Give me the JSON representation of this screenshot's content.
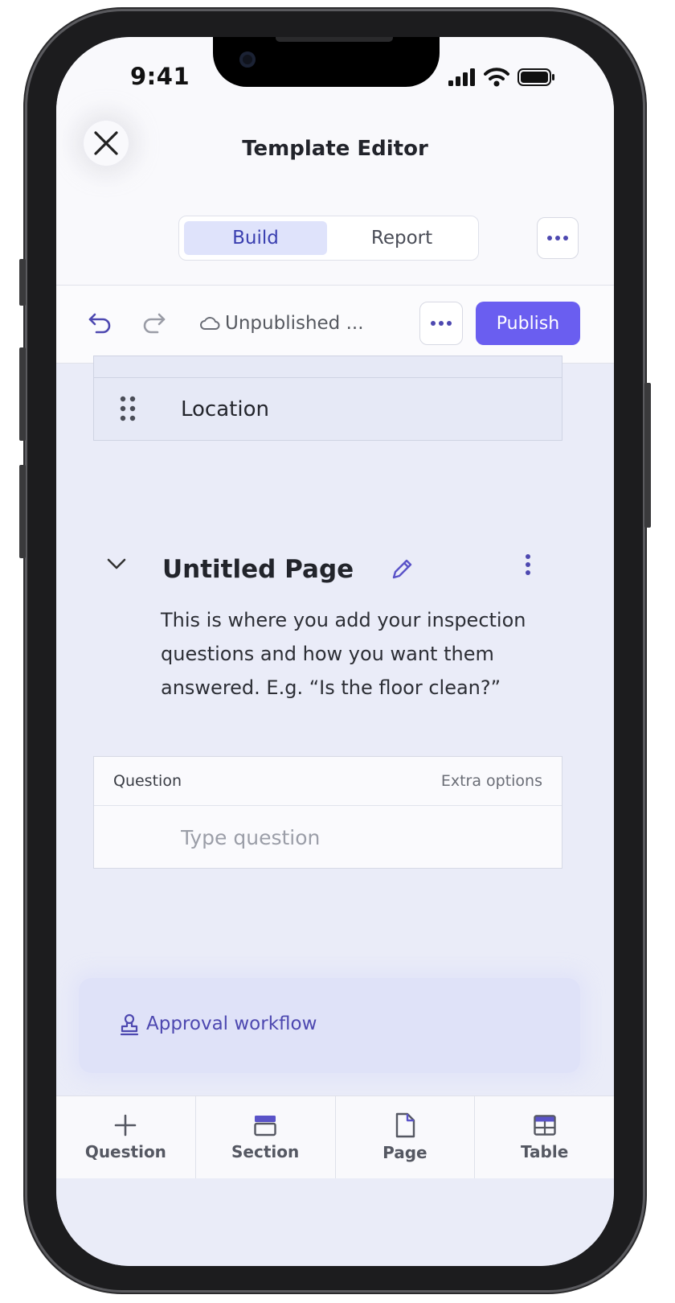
{
  "status_bar": {
    "time": "9:41"
  },
  "header": {
    "title": "Template Editor",
    "tabs": [
      {
        "label": "Build",
        "active": true
      },
      {
        "label": "Report",
        "active": false
      }
    ]
  },
  "toolbar": {
    "status": "Unpublished ...",
    "publish_label": "Publish"
  },
  "content": {
    "previous_item_label": "Location",
    "page": {
      "title": "Untitled Page",
      "description": "This is where you add your inspection questions and how you want them answered. E.g. “Is the floor clean?”"
    },
    "question_card": {
      "header_left": "Question",
      "header_right": "Extra options",
      "placeholder": "Type question"
    },
    "approval": {
      "label": "Approval workflow"
    }
  },
  "bottom_bar": {
    "items": [
      {
        "label": "Question",
        "icon": "plus-icon"
      },
      {
        "label": "Section",
        "icon": "section-icon"
      },
      {
        "label": "Page",
        "icon": "page-icon"
      },
      {
        "label": "Table",
        "icon": "table-icon"
      }
    ]
  },
  "colors": {
    "accent": "#6a5ef0",
    "accent_text": "#4d48b0",
    "background": "#eaecf8"
  }
}
